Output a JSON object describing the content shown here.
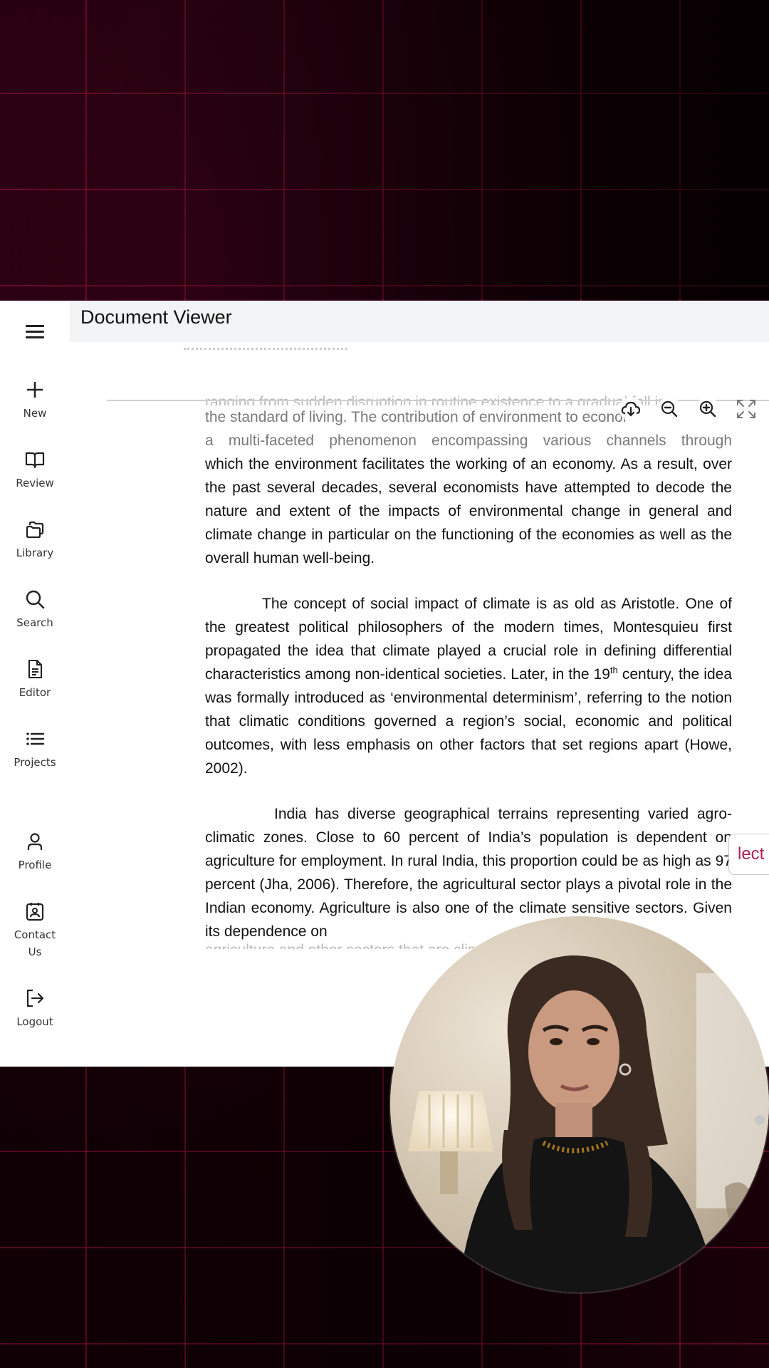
{
  "window": {
    "title": "Document Viewer"
  },
  "sidebar": {
    "items": [
      {
        "label": "New",
        "icon": "plus-icon"
      },
      {
        "label": "Review",
        "icon": "book-open-icon"
      },
      {
        "label": "Library",
        "icon": "library-icon"
      },
      {
        "label": "Search",
        "icon": "search-icon"
      },
      {
        "label": "Editor",
        "icon": "document-icon"
      },
      {
        "label": "Projects",
        "icon": "list-icon"
      },
      {
        "label": "Profile",
        "icon": "user-icon"
      },
      {
        "label": "Contact Us",
        "icon": "contact-card-icon"
      },
      {
        "label": "Logout",
        "icon": "logout-icon"
      }
    ]
  },
  "toolbar": {
    "tools": [
      "cloud-download-icon",
      "zoom-out-icon",
      "zoom-in-icon",
      "fullscreen-icon"
    ]
  },
  "document": {
    "cut_top_line": "ranging from sudden disruption in routine existence to a gradual fall in",
    "p1_line1": "the standard of living. The contribution of environment to economy is",
    "p1_line2": "a multi-faceted phenomenon encompassing various channels through",
    "p1_rest": "which the environment facilitates the working of an economy. As a result, over the past several decades, several economists have attempted to decode the nature and extent of the impacts of environmental change in general and climate change in particular on the functioning of the economies as well as the overall human well-being.",
    "p2_a": "The concept of social impact of climate is as old as Aristotle. One of the greatest political philosophers of the modern times, Montesquieu first propagated the idea that climate played a crucial role in defining differential characteristics among non-identical societies.  Later, in the 19",
    "p2_sup": "th",
    "p2_b": " century, the idea was formally introduced as ‘environmental determinism’, referring to the notion that climatic conditions governed a region’s social, economic and political outcomes, with less emphasis on other factors that set regions apart (Howe, 2002).",
    "p3": "India has diverse geographical terrains representing varied agro-climatic zones. Close to 60 percent of India’s population is dependent on agriculture for employment. In rural India, this proportion could be as high as 97 percent (Jha, 2006). Therefore, the agricultural sector plays a pivotal role in the Indian economy. Agriculture is also one of the climate sensitive sectors. Given its dependence on",
    "cut_bottom_line": "agriculture and other sectors that are climate sensitive"
  },
  "select_button": {
    "label": "lect"
  },
  "colors": {
    "accent": "#b0204f",
    "background": "#1a0008"
  }
}
